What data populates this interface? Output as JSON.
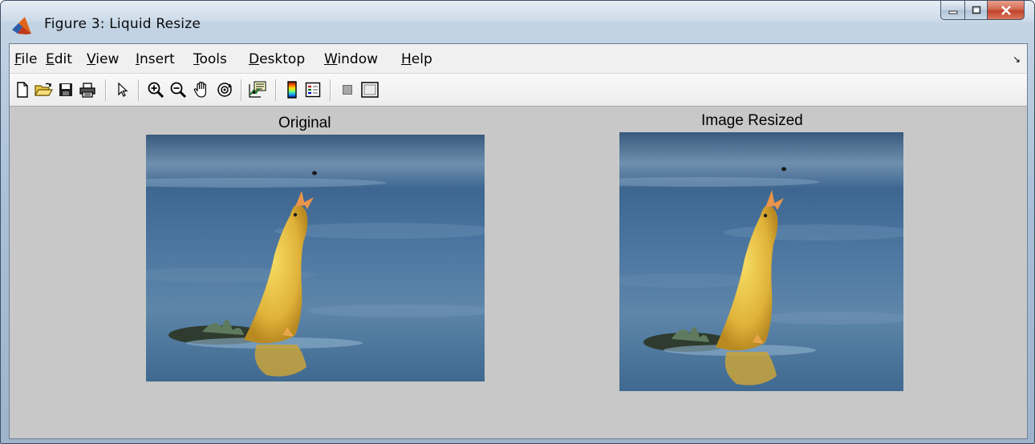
{
  "window": {
    "title": "Figure 3: Liquid Resize",
    "app_icon": "matlab-icon",
    "controls": {
      "minimize": "minimize-icon",
      "maximize": "maximize-icon",
      "close": "close-icon"
    }
  },
  "menubar": {
    "items": [
      {
        "label": "File",
        "hotkey": "F",
        "rest": "ile"
      },
      {
        "label": "Edit",
        "hotkey": "E",
        "rest": "dit"
      },
      {
        "label": "View",
        "hotkey": "V",
        "rest": "iew"
      },
      {
        "label": "Insert",
        "hotkey": "I",
        "rest": "nsert"
      },
      {
        "label": "Tools",
        "hotkey": "T",
        "rest": "ools"
      },
      {
        "label": "Desktop",
        "hotkey": "D",
        "rest": "esktop"
      },
      {
        "label": "Window",
        "hotkey": "W",
        "rest": "indow"
      },
      {
        "label": "Help",
        "hotkey": "H",
        "rest": "elp"
      }
    ],
    "dock_icon": "dock-arrow-icon"
  },
  "toolbar": {
    "tools": [
      "new-figure-icon",
      "open-file-icon",
      "save-icon",
      "print-icon",
      "edit-plot-icon",
      "zoom-in-icon",
      "zoom-out-icon",
      "pan-icon",
      "rotate-3d-icon",
      "data-cursor-icon",
      "insert-colorbar-icon",
      "insert-legend-icon",
      "hide-plot-tools-icon",
      "show-plot-tools-icon"
    ]
  },
  "figure": {
    "background": "#c8c8c8",
    "axes": [
      {
        "title": "Original",
        "image": "duckling-photo"
      },
      {
        "title": "Image Resized",
        "image": "duckling-photo-resized"
      }
    ]
  }
}
